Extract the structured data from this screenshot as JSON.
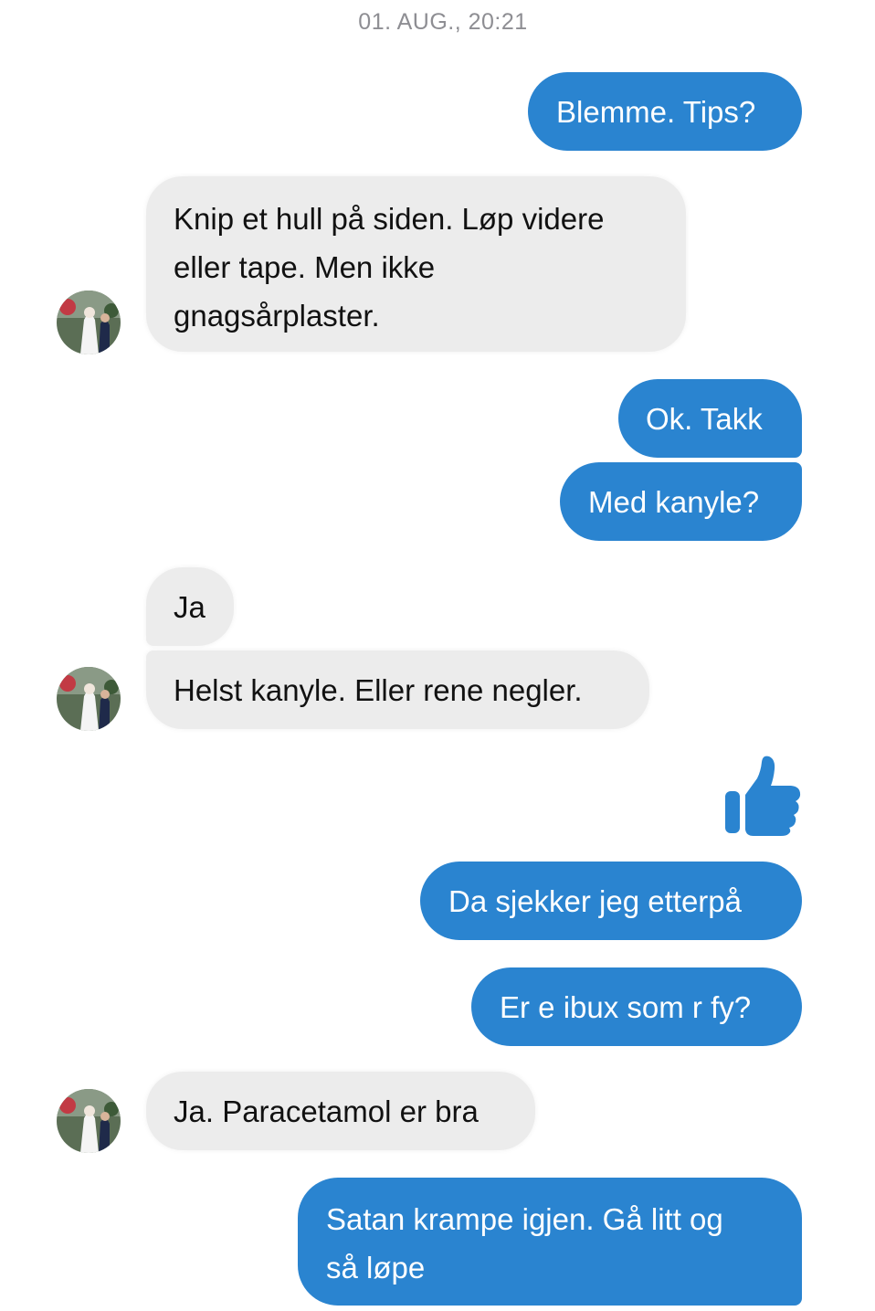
{
  "conversation": {
    "timestamp": "01. AUG., 20:21",
    "messages": [
      {
        "from": "me",
        "text": "Blemme. Tips?"
      },
      {
        "from": "them",
        "lines": [
          "Knip et hull på siden. Løp videre",
          "eller tape. Men ikke",
          "gnagsårplaster."
        ]
      },
      {
        "from": "me",
        "text": "Ok. Takk"
      },
      {
        "from": "me",
        "text": "Med kanyle?"
      },
      {
        "from": "them",
        "text": "Ja"
      },
      {
        "from": "them",
        "text": "Helst kanyle. Eller rene negler."
      },
      {
        "from": "me",
        "type": "like",
        "icon": "thumbs-up-icon"
      },
      {
        "from": "me",
        "text": "Da sjekker jeg etterpå"
      },
      {
        "from": "me",
        "text": "Er e ibux som r fy?"
      },
      {
        "from": "them",
        "text": "Ja. Paracetamol er bra"
      },
      {
        "from": "me",
        "lines": [
          "Satan krampe igjen. Gå litt og",
          "så løpe"
        ]
      }
    ]
  },
  "colors": {
    "outgoing_bubble": "#2a84d0",
    "incoming_bubble": "#ececec",
    "timestamp_text": "#8e8e93"
  }
}
